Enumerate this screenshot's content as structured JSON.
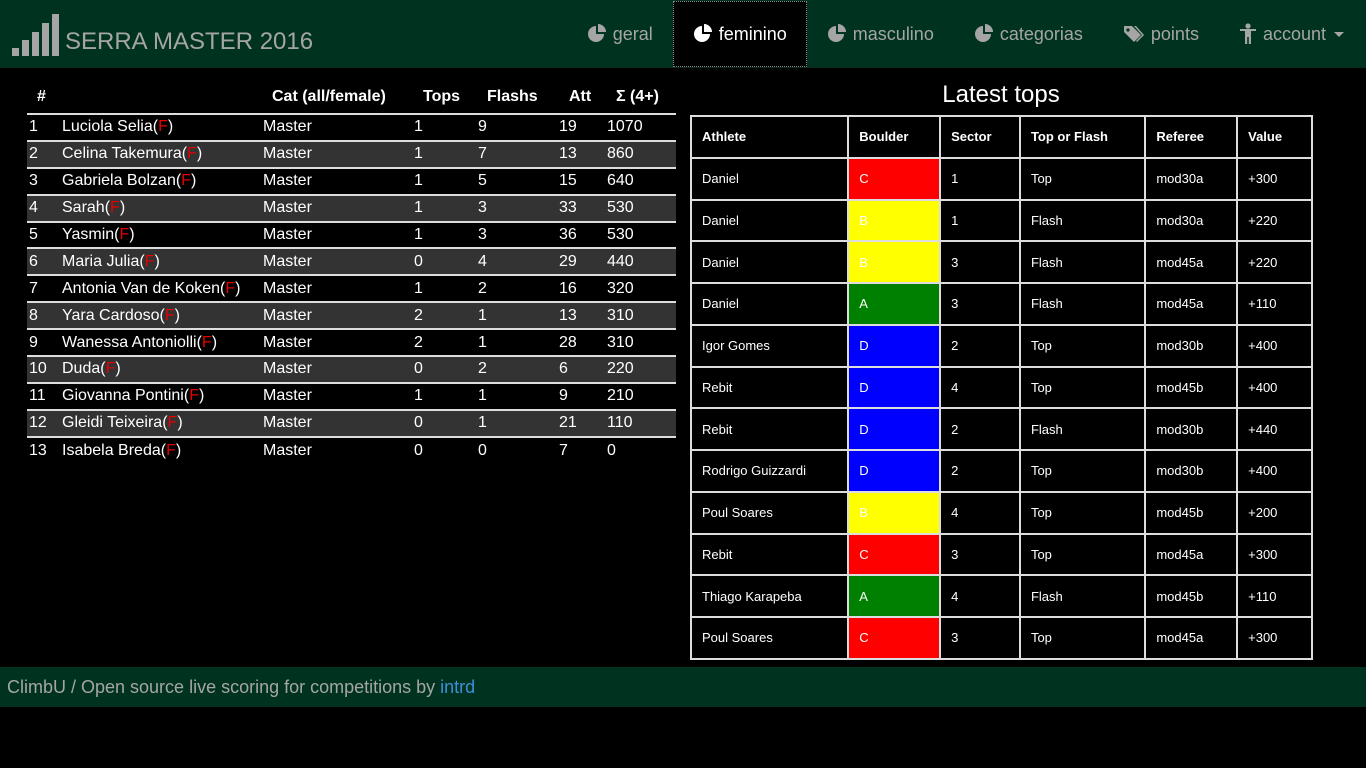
{
  "app": {
    "title": "SERRA MASTER 2016"
  },
  "nav": {
    "items": [
      {
        "label": "geral",
        "icon": "pie-chart-icon",
        "active": false
      },
      {
        "label": "feminino",
        "icon": "pie-chart-icon",
        "active": true
      },
      {
        "label": "masculino",
        "icon": "pie-chart-icon",
        "active": false
      },
      {
        "label": "categorias",
        "icon": "pie-chart-icon",
        "active": false
      },
      {
        "label": "points",
        "icon": "tags-icon",
        "active": false
      },
      {
        "label": "account",
        "icon": "person-icon",
        "active": false,
        "dropdown": true
      }
    ]
  },
  "ranking": {
    "headers": {
      "rank": "#",
      "cat": "Cat (all/female)",
      "tops": "Tops",
      "flashes": "Flashs",
      "att": "Att",
      "sum": "Σ (4+)"
    },
    "female_mark": "F",
    "rows": [
      {
        "rank": "1",
        "name": "Luciola Selia",
        "cat": "Master",
        "tops": "1",
        "flashes": "9",
        "att": "19",
        "sum": "1070"
      },
      {
        "rank": "2",
        "name": "Celina Takemura",
        "cat": "Master",
        "tops": "1",
        "flashes": "7",
        "att": "13",
        "sum": "860"
      },
      {
        "rank": "3",
        "name": "Gabriela Bolzan",
        "cat": "Master",
        "tops": "1",
        "flashes": "5",
        "att": "15",
        "sum": "640"
      },
      {
        "rank": "4",
        "name": "Sarah",
        "cat": "Master",
        "tops": "1",
        "flashes": "3",
        "att": "33",
        "sum": "530"
      },
      {
        "rank": "5",
        "name": "Yasmin",
        "cat": "Master",
        "tops": "1",
        "flashes": "3",
        "att": "36",
        "sum": "530"
      },
      {
        "rank": "6",
        "name": "Maria Julia",
        "cat": "Master",
        "tops": "0",
        "flashes": "4",
        "att": "29",
        "sum": "440"
      },
      {
        "rank": "7",
        "name": "Antonia Van de Koken",
        "cat": "Master",
        "tops": "1",
        "flashes": "2",
        "att": "16",
        "sum": "320"
      },
      {
        "rank": "8",
        "name": "Yara Cardoso",
        "cat": "Master",
        "tops": "2",
        "flashes": "1",
        "att": "13",
        "sum": "310"
      },
      {
        "rank": "9",
        "name": "Wanessa Antoniolli",
        "cat": "Master",
        "tops": "2",
        "flashes": "1",
        "att": "28",
        "sum": "310"
      },
      {
        "rank": "10",
        "name": "Duda",
        "cat": "Master",
        "tops": "0",
        "flashes": "2",
        "att": "6",
        "sum": "220"
      },
      {
        "rank": "11",
        "name": "Giovanna Pontini",
        "cat": "Master",
        "tops": "1",
        "flashes": "1",
        "att": "9",
        "sum": "210"
      },
      {
        "rank": "12",
        "name": "Gleidi Teixeira",
        "cat": "Master",
        "tops": "0",
        "flashes": "1",
        "att": "21",
        "sum": "110"
      },
      {
        "rank": "13",
        "name": "Isabela Breda",
        "cat": "Master",
        "tops": "0",
        "flashes": "0",
        "att": "7",
        "sum": "0"
      }
    ]
  },
  "latest": {
    "title": "Latest tops",
    "headers": {
      "athlete": "Athlete",
      "boulder": "Boulder",
      "sector": "Sector",
      "type": "Top or Flash",
      "referee": "Referee",
      "value": "Value"
    },
    "boulder_colors": {
      "A": "#008000",
      "B": "#ffff00",
      "C": "#ff0000",
      "D": "#0000ff"
    },
    "rows": [
      {
        "athlete": "Daniel",
        "boulder": "C",
        "sector": "1",
        "type": "Top",
        "referee": "mod30a",
        "value": "+300"
      },
      {
        "athlete": "Daniel",
        "boulder": "B",
        "sector": "1",
        "type": "Flash",
        "referee": "mod30a",
        "value": "+220"
      },
      {
        "athlete": "Daniel",
        "boulder": "B",
        "sector": "3",
        "type": "Flash",
        "referee": "mod45a",
        "value": "+220"
      },
      {
        "athlete": "Daniel",
        "boulder": "A",
        "sector": "3",
        "type": "Flash",
        "referee": "mod45a",
        "value": "+110"
      },
      {
        "athlete": "Igor Gomes",
        "boulder": "D",
        "sector": "2",
        "type": "Top",
        "referee": "mod30b",
        "value": "+400"
      },
      {
        "athlete": "Rebit",
        "boulder": "D",
        "sector": "4",
        "type": "Top",
        "referee": "mod45b",
        "value": "+400"
      },
      {
        "athlete": "Rebit",
        "boulder": "D",
        "sector": "2",
        "type": "Flash",
        "referee": "mod30b",
        "value": "+440"
      },
      {
        "athlete": "Rodrigo Guizzardi",
        "boulder": "D",
        "sector": "2",
        "type": "Top",
        "referee": "mod30b",
        "value": "+400"
      },
      {
        "athlete": "Poul Soares",
        "boulder": "B",
        "sector": "4",
        "type": "Top",
        "referee": "mod45b",
        "value": "+200"
      },
      {
        "athlete": "Rebit",
        "boulder": "C",
        "sector": "3",
        "type": "Top",
        "referee": "mod45a",
        "value": "+300"
      },
      {
        "athlete": "Thiago Karapeba",
        "boulder": "A",
        "sector": "4",
        "type": "Flash",
        "referee": "mod45b",
        "value": "+110"
      },
      {
        "athlete": "Poul Soares",
        "boulder": "C",
        "sector": "3",
        "type": "Top",
        "referee": "mod45a",
        "value": "+300"
      }
    ]
  },
  "footer": {
    "text": "ClimbU / Open source live scoring for competitions by ",
    "link": "intrd"
  }
}
